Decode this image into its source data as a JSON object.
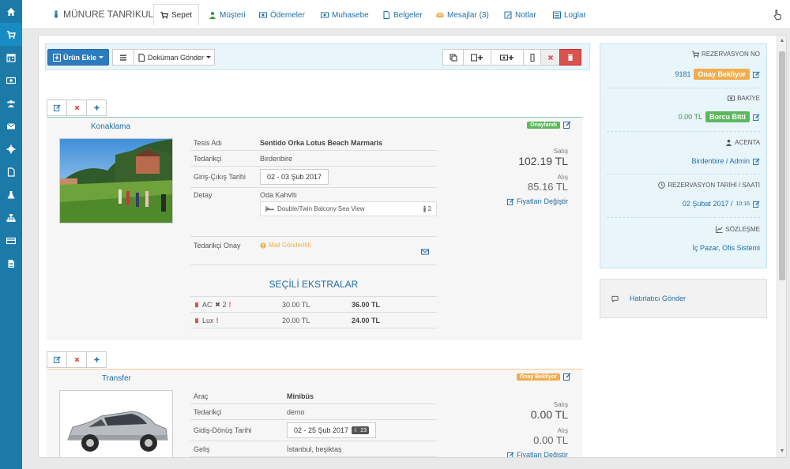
{
  "header": {
    "customer_name": "MÜNURE TANRIKULU",
    "tabs": [
      {
        "label": "Sepet"
      },
      {
        "label": "Müşteri"
      },
      {
        "label": "Ödemeler"
      },
      {
        "label": "Muhasebe"
      },
      {
        "label": "Belgeler"
      },
      {
        "label": "Mesajlar (3)"
      },
      {
        "label": "Notlar"
      },
      {
        "label": "Loglar"
      }
    ]
  },
  "toolbar": {
    "add_product_label": "Ürün Ekle",
    "send_document_label": "Doküman Gönder"
  },
  "cards": [
    {
      "title": "Konaklama",
      "status": "Onaylandı",
      "details": {
        "facility_label": "Tesis Adı",
        "facility_value": "Sentido Orka Lotus Beach Marmaris",
        "supplier_label": "Tedarikçi",
        "supplier_value": "Birdenbire",
        "dates_label": "Giriş-Çıkış Tarihi",
        "dates_value": "02 - 03 Şub 2017",
        "detail_label": "Detay",
        "detail_value": "Oda Kahvltı",
        "room_value": "Double/Twin Balcony Sea View",
        "pax_value": "2",
        "supplier_confirm_label": "Tedarikçi Onay",
        "supplier_confirm_value": "Mail Gönderildi"
      },
      "prices": {
        "sale_label": "Satış",
        "sale_value": "102.19 TL",
        "purchase_label": "Alış",
        "purchase_value": "85.16 TL",
        "change_label": "Fiyatları Değiştir"
      },
      "extras_title": "SEÇİLİ EKSTRALAR",
      "extras": [
        {
          "name": "AC",
          "qty": "2",
          "unit": "30.00 TL",
          "total": "36.00 TL"
        },
        {
          "name": "Lux",
          "qty": "",
          "unit": "20.00 TL",
          "total": "24.00 TL"
        }
      ]
    },
    {
      "title": "Transfer",
      "status": "Onay Bekliyor",
      "details": {
        "vehicle_label": "Araç",
        "vehicle_value": "Minibüs",
        "supplier_label": "Tedarikçi",
        "supplier_value": "demo",
        "dates_label": "Gidiş-Dönüş Tarihi",
        "dates_value": "02 - 25 Şub 2017",
        "nights_value": "23",
        "arrival_label": "Geliş",
        "arrival_value": "İstanbul, beşiktaş"
      },
      "prices": {
        "sale_label": "Satış",
        "sale_value": "0.00 TL",
        "purchase_label": "Alış",
        "purchase_value": "0.00 TL",
        "change_label": "Fiyatları Değiştir"
      }
    }
  ],
  "summary": {
    "reservation_no_label": "REZERVASYON NO",
    "reservation_no": "9181",
    "reservation_status": "Onay Bekliyor",
    "balance_label": "BAKİYE",
    "balance_value": "0.00 TL",
    "balance_status": "Borcu Bitti",
    "agency_label": "ACENTA",
    "agency_value": "Birdenbire / Admin",
    "date_label": "REZERVASYON TARİHİ / SAATİ",
    "date_value": "02 Şubat 2017 /",
    "time_value": "10:16",
    "contract_label": "SÖZLEŞME",
    "contract_value": "İç Pazar, Ofis Sistemi"
  },
  "reminder": {
    "label": "Hatırlatıcı Gönder"
  },
  "colors": {
    "sidebar": "#1b7aa8",
    "accent": "#1f6fa8",
    "warning": "#f0ad4e",
    "success": "#5cb85c",
    "danger": "#d9534f"
  }
}
